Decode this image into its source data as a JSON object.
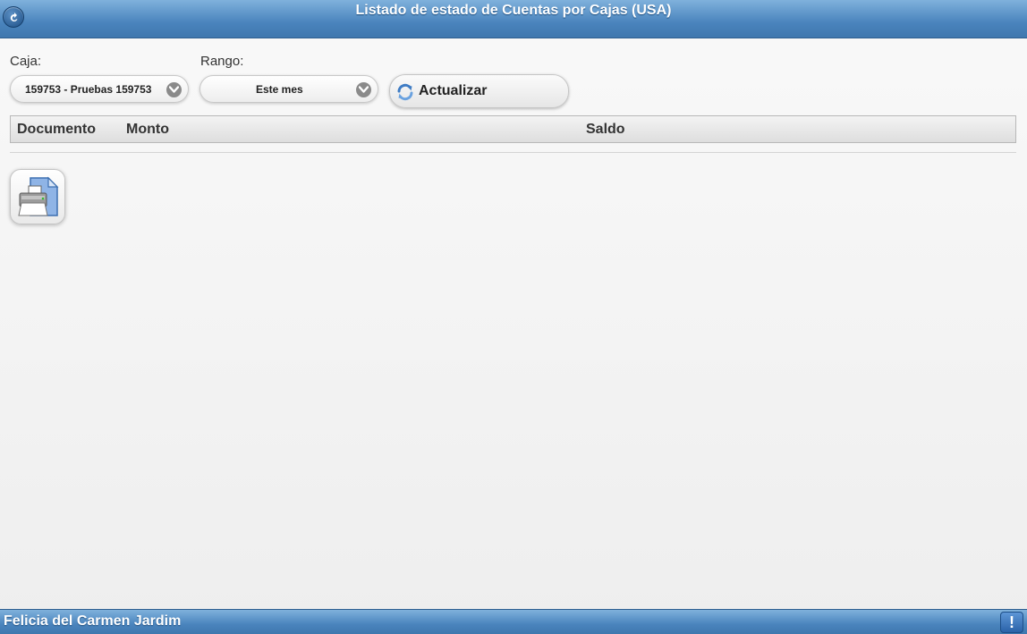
{
  "header": {
    "title": "Listado de estado de Cuentas por Cajas (USA)",
    "back_icon": "back-arrow-icon"
  },
  "filters": {
    "caja_label": "Caja:",
    "caja_value": "159753 - Pruebas 159753",
    "rango_label": "Rango:",
    "rango_value": "Este mes",
    "update_label": "Actualizar",
    "update_icon": "refresh-icon"
  },
  "table": {
    "columns": [
      "Documento",
      "Monto",
      "Saldo"
    ],
    "rows": []
  },
  "actions": {
    "print_icon": "printer-document-icon"
  },
  "footer": {
    "user": "Felicia del Carmen Jardim",
    "alert_symbol": "!"
  },
  "colors": {
    "bar_top": "#7fb1dc",
    "bar_bottom": "#3f77ae",
    "background": "#f4f4f4"
  }
}
